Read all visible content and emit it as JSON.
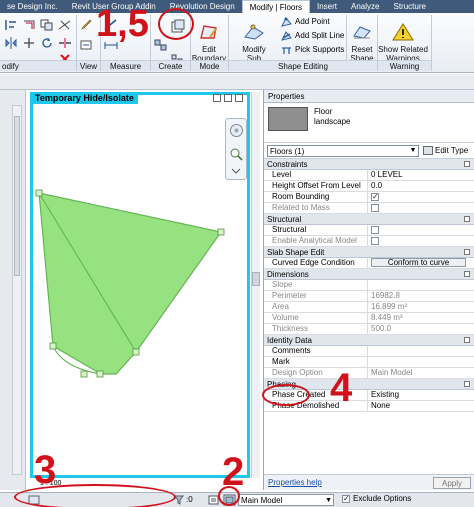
{
  "tabs": [
    {
      "label": "se Design Inc."
    },
    {
      "label": "Revit User Group Addin"
    },
    {
      "label": "Revolution Design"
    },
    {
      "label": "Modify | Floors"
    },
    {
      "label": "Insert"
    },
    {
      "label": "Analyze"
    },
    {
      "label": "Structure"
    }
  ],
  "ribbon": {
    "panels": {
      "modify": "odify",
      "view": "View",
      "measure": "Measure",
      "create": "Create",
      "mode": "Mode",
      "shape_editing": "Shape Editing",
      "warning": "Warning"
    },
    "buttons": {
      "edit_boundary": [
        "Edit",
        "Boundary"
      ],
      "modify_sub_elements": [
        "Modify",
        "Sub Elements"
      ],
      "add_point": "Add Point",
      "add_split_line": "Add Split Line",
      "pick_supports": "Pick Supports",
      "reset_shape": [
        "Reset",
        "Shape"
      ],
      "show_related_warnings": [
        "Show Related",
        "Warnings"
      ]
    }
  },
  "annotations": {
    "one_five": "1,5",
    "two": "2",
    "three": "3",
    "four": "4"
  },
  "view": {
    "title": "Temporary Hide/Isolate",
    "scale": "1 : 100"
  },
  "properties": {
    "title": "Properties",
    "type_family": "Floor",
    "type_name": "landscape",
    "selector": "Floors (1)",
    "edit_type": "Edit Type",
    "groups": {
      "constraints": "Constraints",
      "structural": "Structural",
      "slab_shape_edit": "Slab Shape Edit",
      "dimensions": "Dimensions",
      "identity_data": "Identity Data",
      "phasing": "Phasing"
    },
    "rows": {
      "level": {
        "name": "Level",
        "value": "0 LEVEL"
      },
      "height_offset": {
        "name": "Height Offset From Level",
        "value": "0.0"
      },
      "room_bounding": {
        "name": "Room Bounding"
      },
      "related_to_mass": {
        "name": "Related to Mass"
      },
      "structural": {
        "name": "Structural"
      },
      "enable_analytical": {
        "name": "Enable Analytical Model"
      },
      "curved_edge": {
        "name": "Curved Edge Condition",
        "value": "Conform to curve"
      },
      "slope": {
        "name": "Slope",
        "value": ""
      },
      "perimeter": {
        "name": "Perimeter",
        "value": "16982.8"
      },
      "area": {
        "name": "Area",
        "value": "16.899 m²"
      },
      "volume": {
        "name": "Volume",
        "value": "8.449 m³"
      },
      "thickness": {
        "name": "Thickness",
        "value": "500.0"
      },
      "comments": {
        "name": "Comments",
        "value": ""
      },
      "mark": {
        "name": "Mark",
        "value": ""
      },
      "design_option": {
        "name": "Design Option",
        "value": "Main Model"
      },
      "phase_created": {
        "name": "Phase Created",
        "value": "Existing"
      },
      "phase_demolished": {
        "name": "Phase Demolished",
        "value": "None"
      }
    },
    "help_link": "Properties help",
    "apply": "Apply"
  },
  "status": {
    "zero": ":0",
    "model": "Main Model",
    "exclude_options": "Exclude Options"
  },
  "colors": {
    "accent_cyan": "#1ec8ec",
    "annotation_red": "#d2121a",
    "floor_fill": "#92e17a",
    "floor_stroke": "#5cb24a"
  }
}
